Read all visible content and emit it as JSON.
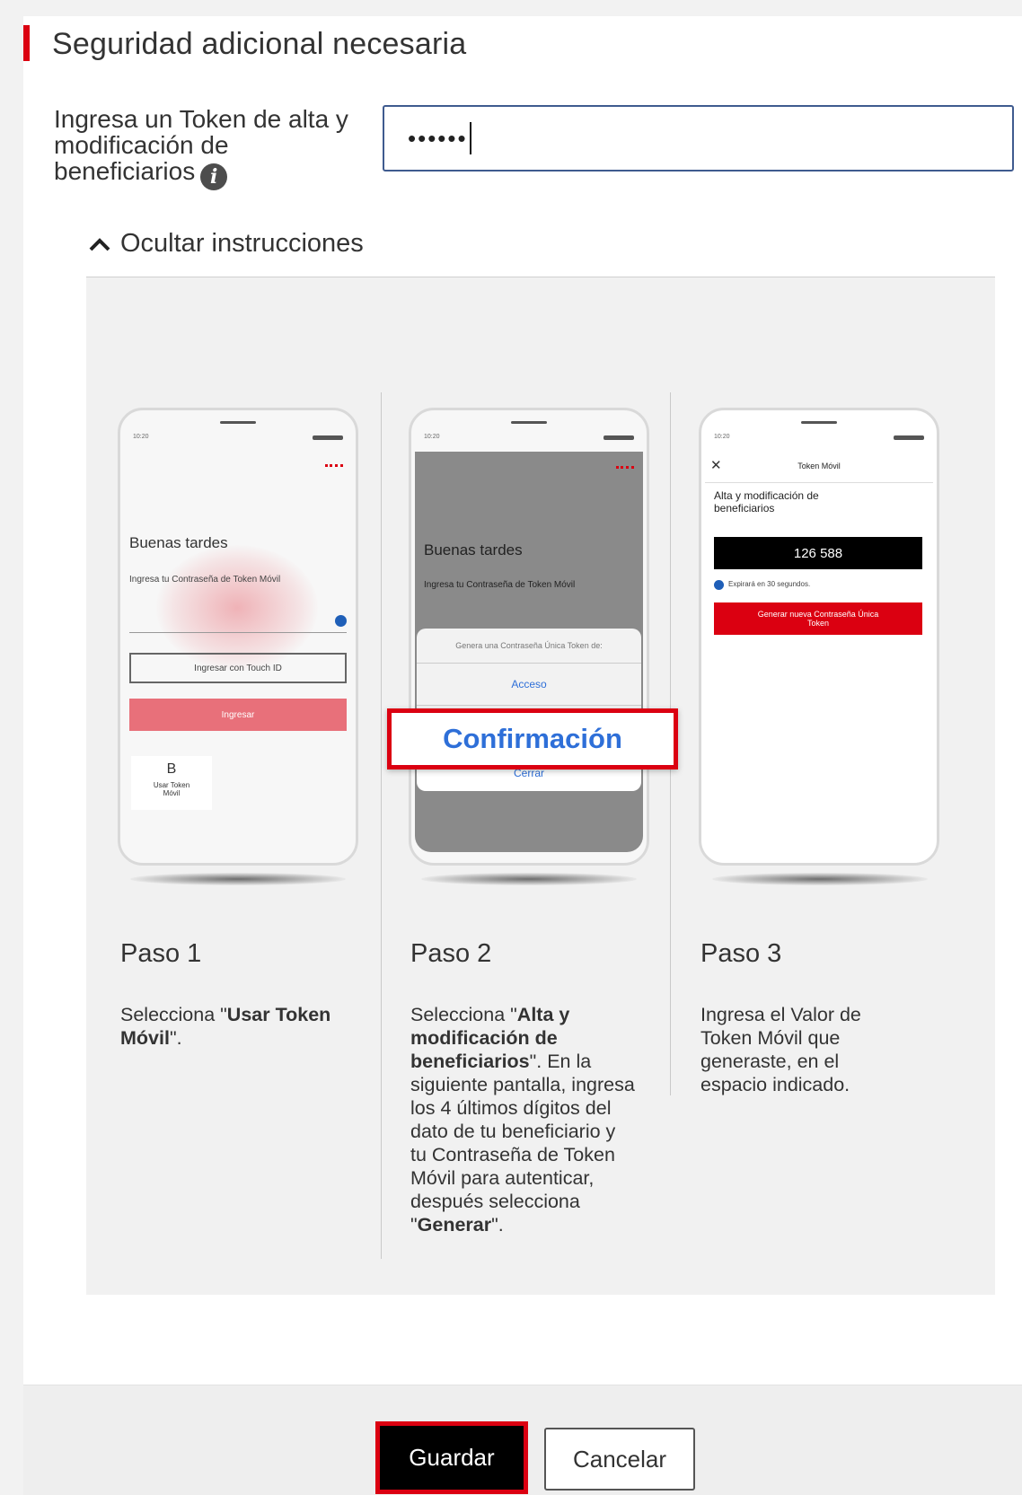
{
  "dialog": {
    "title": "Seguridad adicional necesaria",
    "token_label": "Ingresa un Token de alta y modificación de beneficiarios",
    "token_value": "••••••",
    "toggle_label": "Ocultar instrucciones"
  },
  "steps": [
    {
      "title": "Paso 1",
      "desc_prefix": "Selecciona \"",
      "desc_bold": "Usar Token Móvil",
      "desc_suffix": "\".",
      "phone": {
        "greeting": "Buenas tardes",
        "prompt": "Ingresa tu Contraseña de Token Móvil",
        "touch_button": "Ingresar con Touch ID",
        "login_button": "Ingresar",
        "tile_letter": "B",
        "tile_label": "Usar Token Móvil"
      }
    },
    {
      "title": "Paso 2",
      "desc_prefix": "Selecciona \"",
      "desc_bold": "Alta y modificación de beneficiarios",
      "desc_suffix": "\". En la siguiente pantalla, ingresa los 4 últimos dígitos del dato de tu beneficiario y tu Contraseña de Token Móvil para autenticar, después selecciona \"",
      "desc_bold2": "Generar",
      "desc_end": "\".",
      "phone": {
        "greeting": "Buenas tardes",
        "prompt": "Ingresa tu Contraseña de Token Móvil",
        "sheet_title": "Genera una Contraseña Única Token de:",
        "sheet_access": "Acceso",
        "sheet_close": "Cerrar"
      },
      "highlight": "Confirmación"
    },
    {
      "title": "Paso 3",
      "desc": "Ingresa el Valor de Token Móvil que generaste, en el espacio indicado.",
      "phone": {
        "header": "Token Móvil",
        "subtitle": "Alta y modificación de beneficiarios",
        "code": "126 588",
        "expiry": "Expirará en 30 segundos.",
        "generate_button": "Generar nueva Contraseña Única Token"
      }
    }
  ],
  "footer": {
    "save_label": "Guardar",
    "cancel_label": "Cancelar"
  },
  "colors": {
    "brand_red": "#db0011",
    "link_blue": "#2e6fd8",
    "input_border": "#3f5b8f"
  }
}
